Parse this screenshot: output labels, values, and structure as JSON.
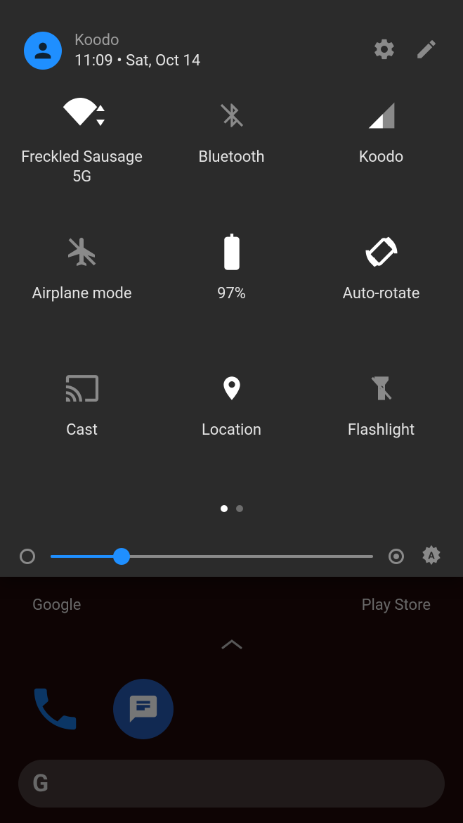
{
  "header": {
    "carrier": "Koodo",
    "time": "11:09",
    "separator": " • ",
    "date": "Sat, Oct 14"
  },
  "tiles": [
    {
      "id": "wifi",
      "label": "Freckled Sausage\n5G",
      "active": true
    },
    {
      "id": "bluetooth",
      "label": "Bluetooth",
      "active": false
    },
    {
      "id": "cellular",
      "label": "Koodo",
      "active": false
    },
    {
      "id": "airplane",
      "label": "Airplane mode",
      "active": false
    },
    {
      "id": "battery",
      "label": "97%",
      "active": true
    },
    {
      "id": "autorotate",
      "label": "Auto-rotate",
      "active": true
    },
    {
      "id": "cast",
      "label": "Cast",
      "active": false
    },
    {
      "id": "location",
      "label": "Location",
      "active": true
    },
    {
      "id": "flashlight",
      "label": "Flashlight",
      "active": false
    }
  ],
  "pager": {
    "pages": 2,
    "current": 0
  },
  "brightness": {
    "percent": 22
  },
  "homescreen": {
    "left_label": "Google",
    "right_label": "Play Store",
    "search_letter": "G"
  },
  "colors": {
    "accent": "#1f8fff",
    "panel": "#2b2b2b",
    "muted": "#8a8a8a"
  }
}
